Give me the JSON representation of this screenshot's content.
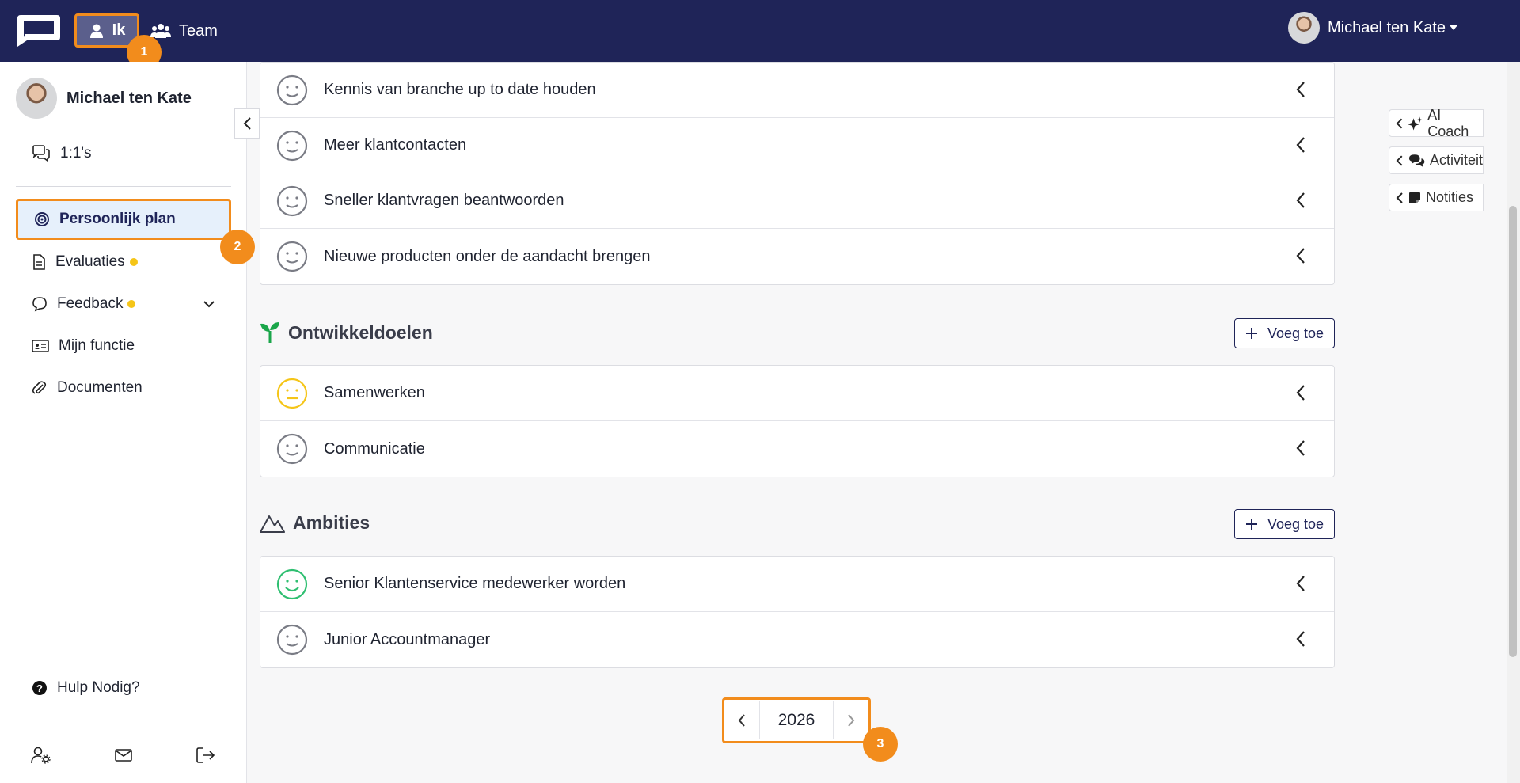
{
  "topbar": {
    "nav_ik_label": "Ik",
    "nav_team_label": "Team",
    "user_name": "Michael ten Kate",
    "badge_1": "1"
  },
  "sidebar": {
    "user_name": "Michael ten Kate",
    "items": [
      {
        "label": "1:1's"
      },
      {
        "label": "Persoonlijk plan"
      },
      {
        "label": "Evaluaties"
      },
      {
        "label": "Feedback"
      },
      {
        "label": "Mijn functie"
      },
      {
        "label": "Documenten"
      }
    ],
    "help_label": "Hulp Nodig?",
    "badge_2": "2"
  },
  "main": {
    "top_goals": [
      {
        "label": "Kennis van branche up to date houden",
        "mood": "neutral"
      },
      {
        "label": "Meer klantcontacten",
        "mood": "neutral"
      },
      {
        "label": "Sneller klantvragen beantwoorden",
        "mood": "neutral"
      },
      {
        "label": "Nieuwe producten onder de aandacht brengen",
        "mood": "neutral"
      }
    ],
    "development": {
      "title": "Ontwikkeldoelen",
      "add_label": "Voeg toe",
      "items": [
        {
          "label": "Samenwerken",
          "mood": "meh"
        },
        {
          "label": "Communicatie",
          "mood": "neutral"
        }
      ]
    },
    "ambitions": {
      "title": "Ambities",
      "add_label": "Voeg toe",
      "items": [
        {
          "label": "Senior Klantenservice medewerker worden",
          "mood": "happy"
        },
        {
          "label": "Junior Accountmanager",
          "mood": "neutral"
        }
      ]
    },
    "pager": {
      "year": "2026",
      "badge_3": "3"
    }
  },
  "right_tabs": [
    {
      "label": "AI Coach"
    },
    {
      "label": "Activiteit"
    },
    {
      "label": "Notities"
    }
  ],
  "colors": {
    "brand": "#1f2458",
    "highlight": "#f28c1c",
    "happy": "#2fbf71",
    "meh": "#f5c518",
    "neutral": "#7a7c85"
  }
}
